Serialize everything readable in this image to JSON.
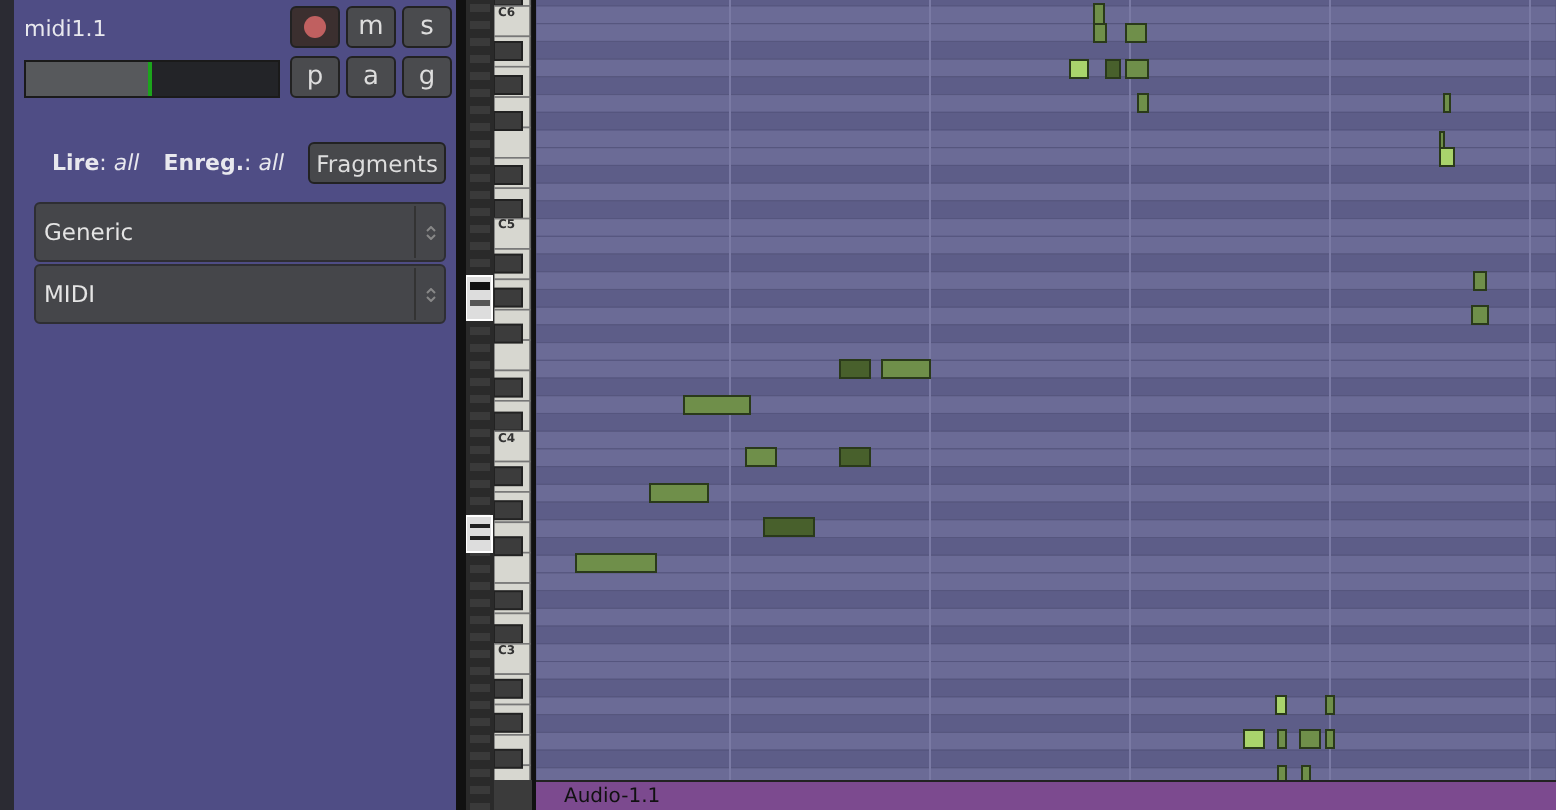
{
  "track": {
    "name": "midi1.1",
    "level": 0.5,
    "buttons": [
      {
        "kind": "record",
        "active": true
      },
      {
        "kind": "text",
        "label": "m"
      },
      {
        "kind": "text",
        "label": "s"
      },
      {
        "kind": "text",
        "label": "p"
      },
      {
        "kind": "text",
        "label": "a"
      },
      {
        "kind": "text",
        "label": "g"
      }
    ],
    "playback": "**Lire**: *all*",
    "record_mode": "**Enreg.**: *all*",
    "fragments_button": "Fragments",
    "dropdowns": [
      "Generic",
      "MIDI"
    ]
  },
  "piano": {
    "octave_labels": [
      "C6",
      "C5",
      "C4",
      "C3"
    ]
  },
  "region": {
    "name": "Audio-1.1"
  }
}
